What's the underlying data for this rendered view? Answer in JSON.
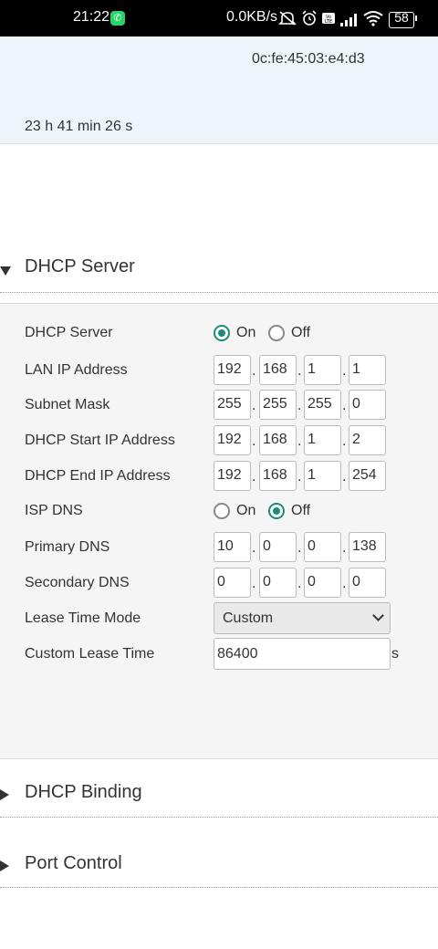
{
  "status_bar": {
    "time": "21:22",
    "network_speed": "0.0KB/s",
    "battery": "58",
    "icons": [
      "whatsapp-icon",
      "mute-icon",
      "alarm-icon",
      "volte-icon",
      "signal-icon",
      "wifi-icon",
      "battery-icon"
    ]
  },
  "info": {
    "mac": "0c:fe:45:03:e4:d3",
    "uptime": "23 h 41 min 26 s"
  },
  "dhcp_server_section": {
    "title": "DHCP Server",
    "expanded": true,
    "rows": {
      "dhcp_server": {
        "label": "DHCP Server",
        "on": "On",
        "off": "Off",
        "selected": "On"
      },
      "lan_ip": {
        "label": "LAN IP Address",
        "octets": [
          "192",
          "168",
          "1",
          "1"
        ]
      },
      "subnet": {
        "label": "Subnet Mask",
        "octets": [
          "255",
          "255",
          "255",
          "0"
        ]
      },
      "start_ip": {
        "label": "DHCP Start IP Address",
        "octets": [
          "192",
          "168",
          "1",
          "2"
        ]
      },
      "end_ip": {
        "label": "DHCP End IP Address",
        "octets": [
          "192",
          "168",
          "1",
          "254"
        ]
      },
      "isp_dns": {
        "label": "ISP DNS",
        "on": "On",
        "off": "Off",
        "selected": "Off"
      },
      "primary_dns": {
        "label": "Primary DNS",
        "octets": [
          "10",
          "0",
          "0",
          "138"
        ]
      },
      "secondary_dns": {
        "label": "Secondary DNS",
        "octets": [
          "0",
          "0",
          "0",
          "0"
        ]
      },
      "lease_mode": {
        "label": "Lease Time Mode",
        "value": "Custom"
      },
      "lease_time": {
        "label": "Custom Lease Time",
        "value": "86400",
        "unit": "s"
      }
    },
    "ip_separator": "."
  },
  "dhcp_binding_section": {
    "title": "DHCP Binding",
    "expanded": false
  },
  "port_control_section": {
    "title": "Port Control",
    "expanded": false
  },
  "colors": {
    "accent": "#1f8a7a",
    "info_bg": "#edf5fb",
    "form_bg": "#f5f5f5"
  }
}
